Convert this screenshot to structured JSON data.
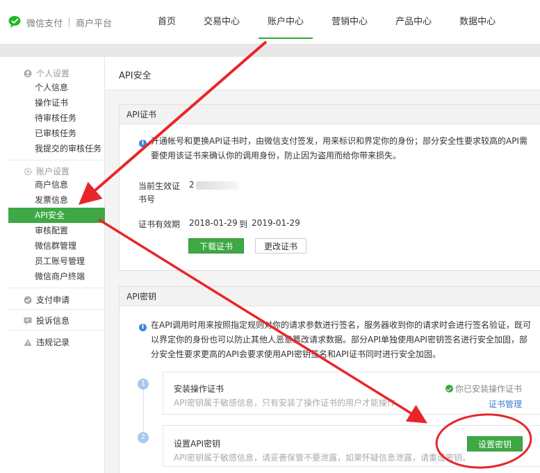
{
  "brand": {
    "name": "微信支付",
    "sub": "商户平台"
  },
  "nav": [
    {
      "label": "首页"
    },
    {
      "label": "交易中心"
    },
    {
      "label": "账户中心",
      "active": true
    },
    {
      "label": "营销中心"
    },
    {
      "label": "产品中心"
    },
    {
      "label": "数据中心"
    }
  ],
  "sidebar": {
    "group1_title": "个人设置",
    "group1_items": [
      "个人信息",
      "操作证书",
      "待审核任务",
      "已审核任务",
      "我提交的审核任务"
    ],
    "group2_title": "账户设置",
    "group2_items": [
      "商户信息",
      "发票信息",
      "API安全",
      "审核配置",
      "微信群管理",
      "员工账号管理",
      "微信商户终端"
    ],
    "links": [
      "支付申请",
      "投诉信息",
      "违规记录"
    ]
  },
  "main": {
    "title": "API安全",
    "cert_panel": {
      "title": "API证书",
      "info_line1": "开通帐号和更换API证书时，由微信支付签发，用来标识和界定你的身份；部分安全性要求较高的API需",
      "info_line2": "要使用该证书来确认你的调用身份，防止因为盗用而给你带来损失。",
      "current_label_1": "当前生效证",
      "current_label_2": "书号",
      "current_value": "2",
      "validity_label": "证书有效期",
      "validity_start": "2018-01-29",
      "validity_to": "到",
      "validity_end": "2019-01-29",
      "download_button": "下载证书",
      "change_button": "更改证书"
    },
    "key_panel": {
      "title": "API密钥",
      "info_line1": "在API调用时用来按照指定规则对你的请求参数进行签名，服务器收到你的请求时会进行签名验证，既可",
      "info_line2": "以界定你的身份也可以防止其他人恶意篡改请求数据。部分API单独使用API密钥签名进行安全加固，部",
      "info_line3": "分安全性要求更高的API会要求使用API密钥签名和API证书同时进行安全加固。",
      "steps": [
        {
          "num": "1",
          "title": "安装操作证书",
          "desc": "API密钥属于敏感信息，只有安装了操作证书的用户才能操作",
          "status": "你已安装操作证书",
          "link": "证书管理"
        },
        {
          "num": "2",
          "title": "设置API密钥",
          "desc": "API密钥属于敏感信息，请妥善保管不要泄露，如果怀疑信息泄露，请重设密钥。",
          "button": "设置密钥"
        }
      ]
    }
  },
  "colors": {
    "accent_green": "#3ea844",
    "annotation_red": "#e8262a",
    "info_blue": "#3a88d8",
    "link_blue": "#3a7fcc"
  },
  "icons": {
    "brand": "wechat-pay-logo-icon",
    "group1": "user-circle-icon",
    "group2": "gear-icon",
    "link1": "check-circle-icon",
    "link2": "chat-bubble-icon",
    "link3": "warning-triangle-icon"
  }
}
